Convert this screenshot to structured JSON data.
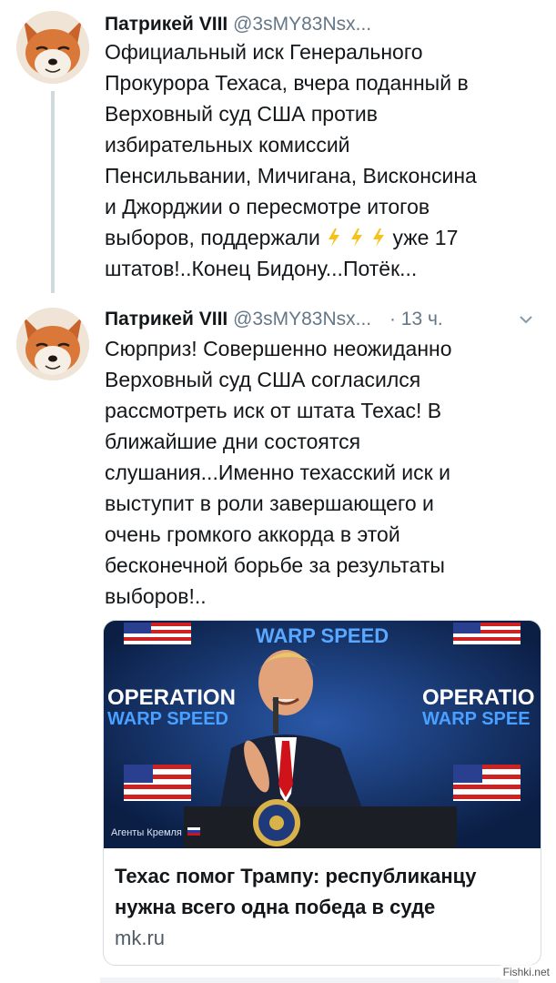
{
  "tweets": [
    {
      "author_name": "Патрикей VIII",
      "handle": "@3sMY83Nsx...",
      "text_part1": "Официальный иск Генерального\nПрокурора Техаса, вчера поданный в\nВерховный суд США против\nизбирательных комиссий\nПенсильвании, Мичигана, Висконсина\nи Джорджии о пересмотре итогов\nвыборов, поддержали ",
      "text_part2": " уже 17\nштатов!..Конец Бидону...Потёк...",
      "emoji": [
        "lightning-icon",
        "lightning-icon",
        "lightning-icon"
      ]
    },
    {
      "author_name": "Патрикей VIII",
      "handle": "@3sMY83Nsx...",
      "time": "· 13 ч.",
      "text": "Сюрприз! Совершенно неожиданно\nВерховный суд США согласился\nрассмотреть иск от штата Техас! В\nближайшие дни состоятся\nслушания...Именно техасский иск и\nвыступит в роли завершающего и\nочень громкого аккорда в этой\nбесконечной борьбе за результаты\nвыборов!..",
      "card": {
        "title": "Техас помог Трампу: республиканцу нужна всего одна победа в суде",
        "domain": "mk.ru",
        "image_texts": {
          "top": "WARP SPEED",
          "left_line1": "OPERATION",
          "left_line2": "WARP SPEED",
          "right_line1": "OPERATIO",
          "right_line2": "WARP SPEE",
          "caption": "Агенты Кремля"
        }
      }
    }
  ],
  "watermark": "Fishki.net",
  "colors": {
    "text": "#14171a",
    "secondary": "#657786",
    "card_bg": "#0f2a57",
    "lightning": "#f4c21b"
  }
}
